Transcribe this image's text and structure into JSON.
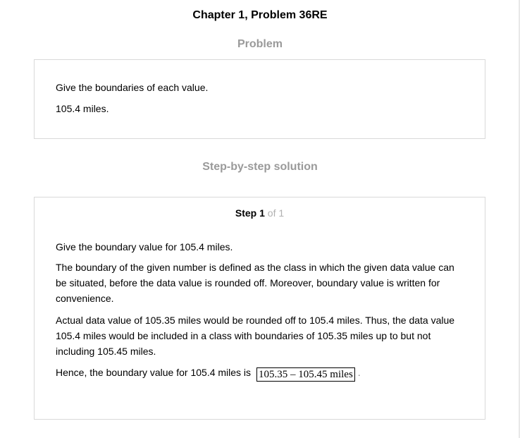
{
  "page_title": "Chapter 1, Problem 36RE",
  "problem": {
    "heading": "Problem",
    "question": "Give the boundaries of each value.",
    "value": "105.4 miles."
  },
  "solution": {
    "heading": "Step-by-step solution",
    "step": {
      "word": "Step",
      "number": "1",
      "total": "of 1"
    },
    "paragraphs": [
      "Give the boundary value for 105.4 miles.",
      "The boundary of the given number is defined as the class in which the given data value can be situated, before the data value is rounded off. Moreover, boundary value is written for convenience.",
      "Actual data value of 105.35 miles would be rounded off to 105.4 miles. Thus, the data value 105.4 miles would be included in a class with boundaries of 105.35 miles up to but not including 105.45 miles."
    ],
    "conclusion": "Hence, the boundary value for 105.4 miles is",
    "answer": "105.35 – 105.45 miles",
    "period": "."
  }
}
